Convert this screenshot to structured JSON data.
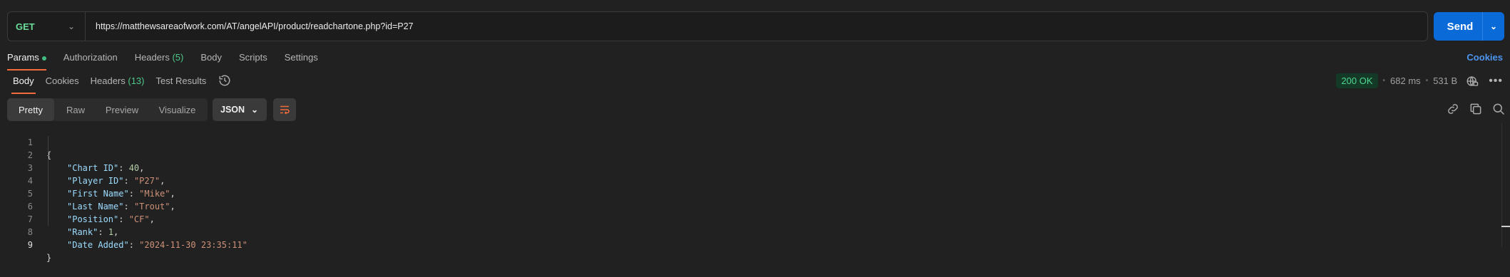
{
  "request": {
    "method": "GET",
    "url": "https://matthewsareaofwork.com/AT/angelAPI/product/readchartone.php?id=P27",
    "send_label": "Send"
  },
  "request_tabs": {
    "params": "Params",
    "authorization": "Authorization",
    "headers": "Headers",
    "headers_count": "(5)",
    "body": "Body",
    "scripts": "Scripts",
    "settings": "Settings",
    "cookies": "Cookies"
  },
  "response_tabs": {
    "body": "Body",
    "cookies": "Cookies",
    "headers": "Headers",
    "headers_count": "(13)",
    "test_results": "Test Results"
  },
  "status": {
    "code": "200 OK",
    "time": "682 ms",
    "size": "531 B"
  },
  "view": {
    "pretty": "Pretty",
    "raw": "Raw",
    "preview": "Preview",
    "visualize": "Visualize",
    "format": "JSON"
  },
  "code_lines": [
    {
      "n": "1"
    },
    {
      "n": "2",
      "key": "\"Chart ID\"",
      "val": "40"
    },
    {
      "n": "3",
      "key": "\"Player ID\"",
      "val": "\"P27\""
    },
    {
      "n": "4",
      "key": "\"First Name\"",
      "val": "\"Mike\""
    },
    {
      "n": "5",
      "key": "\"Last Name\"",
      "val": "\"Trout\""
    },
    {
      "n": "6",
      "key": "\"Position\"",
      "val": "\"CF\""
    },
    {
      "n": "7",
      "key": "\"Rank\"",
      "val": "1"
    },
    {
      "n": "8",
      "key": "\"Date Added\"",
      "val": "\"2024-11-30 23:35:11\""
    },
    {
      "n": "9"
    }
  ],
  "colors": {
    "accent": "#f26b3a",
    "send": "#0a6ad8",
    "status_ok": "#4dd68f"
  }
}
